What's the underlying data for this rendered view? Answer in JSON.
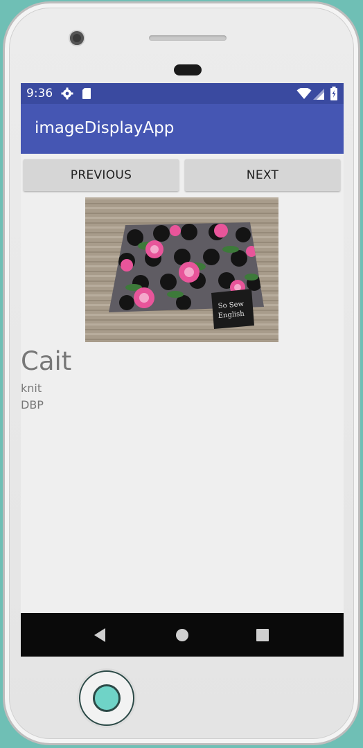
{
  "status_bar": {
    "time": "9:36",
    "icons": [
      "gear-icon",
      "sd-card-icon",
      "wifi-icon",
      "signal-icon",
      "battery-icon"
    ]
  },
  "app_bar": {
    "title": "imageDisplayApp"
  },
  "buttons": {
    "previous": "PREVIOUS",
    "next": "NEXT"
  },
  "image": {
    "description_icon": "fabric-photo",
    "label_text": "So Sew English"
  },
  "record": {
    "name": "Cait",
    "line1": "knit",
    "line2": "DBP"
  },
  "nav_bar": {
    "icons": [
      "back-icon",
      "home-icon",
      "recents-icon"
    ]
  },
  "colors": {
    "status_bar": "#3a4aa0",
    "app_bar": "#4556b3",
    "screen_bg": "#efefef",
    "button_bg": "#d6d6d6",
    "nav_bar": "#0a0a0a",
    "device_bg": "#6fbfb5"
  }
}
